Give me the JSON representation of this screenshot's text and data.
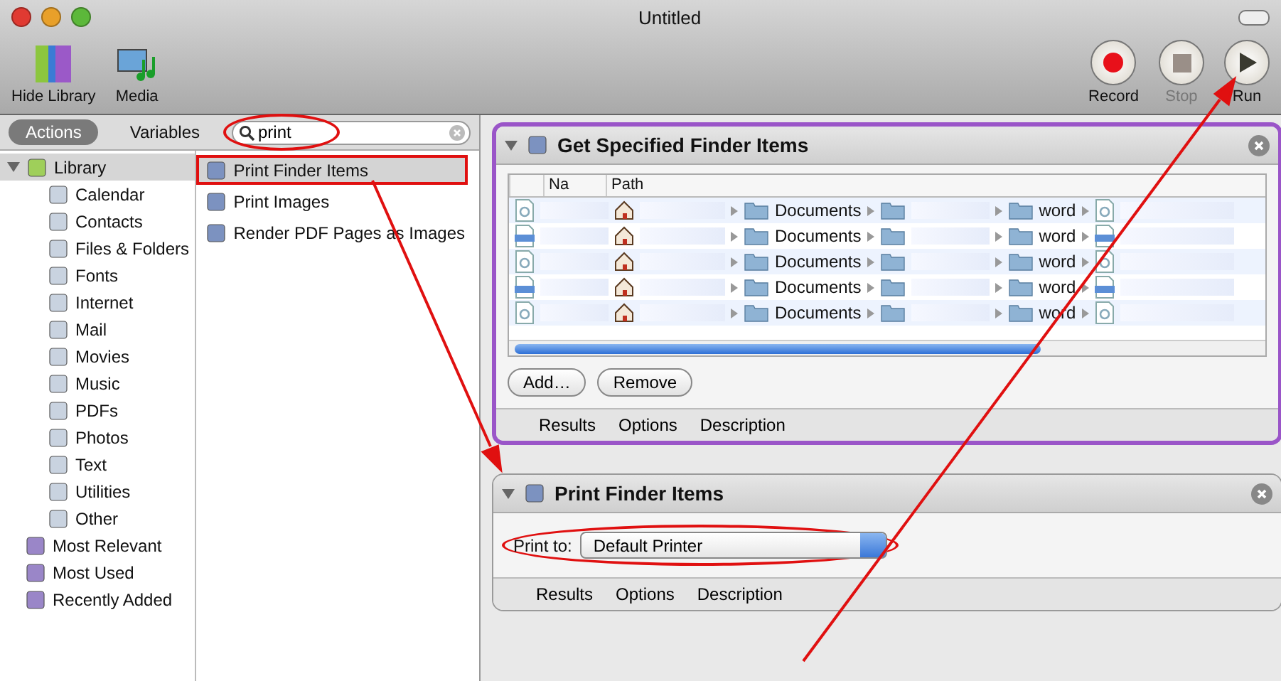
{
  "window": {
    "title": "Untitled"
  },
  "toolbar": {
    "left": [
      {
        "label": "Hide Library",
        "kind": "library"
      },
      {
        "label": "Media",
        "kind": "media"
      }
    ],
    "right": [
      {
        "label": "Record",
        "kind": "record",
        "disabled": false
      },
      {
        "label": "Stop",
        "kind": "stop",
        "disabled": true
      },
      {
        "label": "Run",
        "kind": "run",
        "disabled": false
      }
    ]
  },
  "library_tabs": [
    {
      "label": "Actions",
      "selected": true
    },
    {
      "label": "Variables",
      "selected": false
    }
  ],
  "search": {
    "value": "print",
    "highlighted": true
  },
  "library": {
    "label": "Library",
    "expanded": true,
    "children": [
      {
        "label": "Calendar"
      },
      {
        "label": "Contacts"
      },
      {
        "label": "Files & Folders"
      },
      {
        "label": "Fonts"
      },
      {
        "label": "Internet"
      },
      {
        "label": "Mail"
      },
      {
        "label": "Movies"
      },
      {
        "label": "Music"
      },
      {
        "label": "PDFs"
      },
      {
        "label": "Photos"
      },
      {
        "label": "Text"
      },
      {
        "label": "Utilities"
      },
      {
        "label": "Other"
      }
    ]
  },
  "smart_groups": [
    {
      "label": "Most Relevant"
    },
    {
      "label": "Most Used"
    },
    {
      "label": "Recently Added"
    }
  ],
  "actions": [
    {
      "label": "Print Finder Items",
      "selected": true,
      "highlighted": true
    },
    {
      "label": "Print Images",
      "selected": false,
      "highlighted": false
    },
    {
      "label": "Render PDF Pages as Images",
      "selected": false,
      "highlighted": false
    }
  ],
  "workflow": [
    {
      "kind": "file_list",
      "title": "Get Specified Finder Items",
      "selected": true,
      "columns": [
        "Na",
        "Path"
      ],
      "rows": [
        {
          "kind": "text",
          "folder_1": "Documents",
          "folder_2": "word"
        },
        {
          "kind": "docx",
          "folder_1": "Documents",
          "folder_2": "word"
        },
        {
          "kind": "text",
          "folder_1": "Documents",
          "folder_2": "word"
        },
        {
          "kind": "docx",
          "folder_1": "Documents",
          "folder_2": "word"
        },
        {
          "kind": "text",
          "folder_1": "Documents",
          "folder_2": "word"
        }
      ],
      "buttons": [
        "Add…",
        "Remove"
      ],
      "footer_tabs": [
        "Results",
        "Options",
        "Description"
      ]
    },
    {
      "kind": "popup",
      "title": "Print Finder Items",
      "selected": false,
      "field_label": "Print to:",
      "value": "Default Printer",
      "highlighted": true,
      "footer_tabs": [
        "Results",
        "Options",
        "Description"
      ]
    }
  ],
  "annotation_arrows": true
}
